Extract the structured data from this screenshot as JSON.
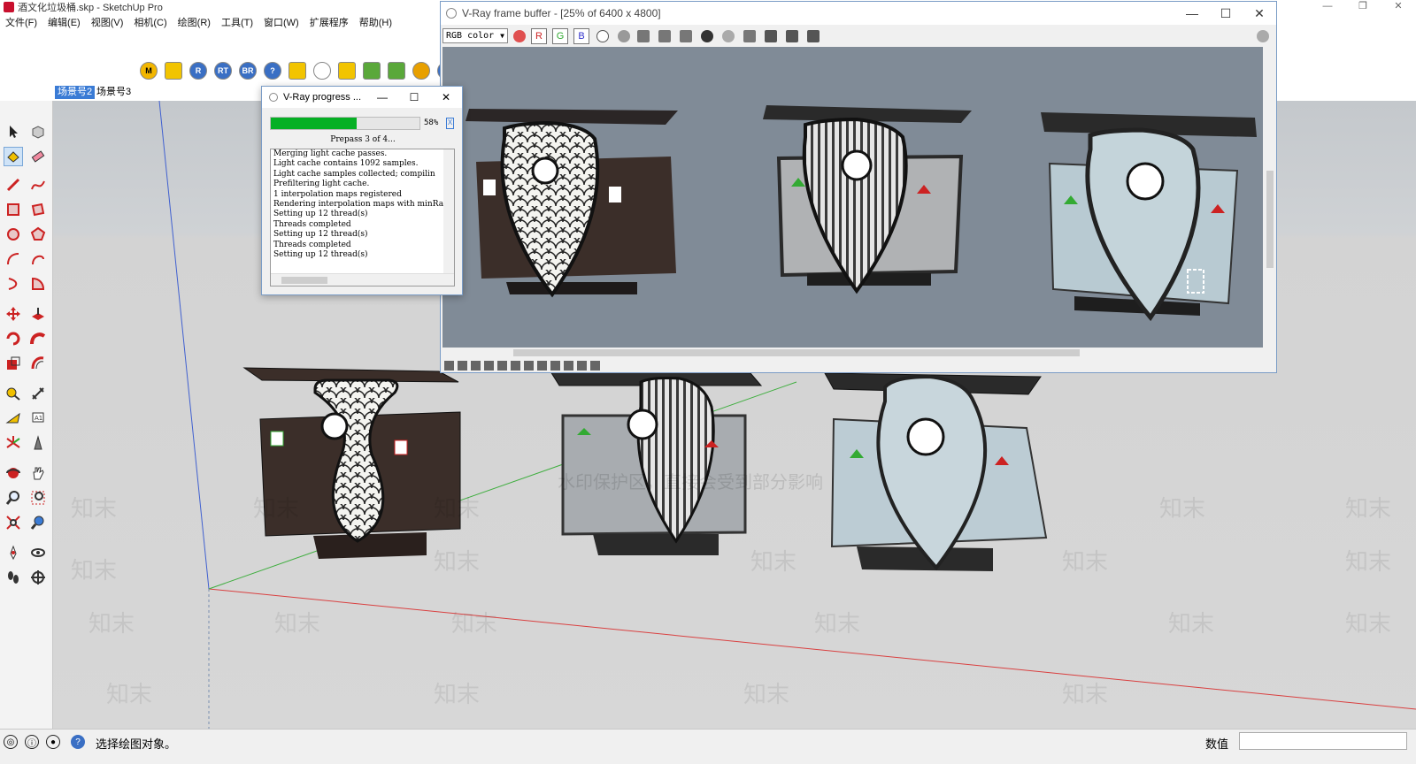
{
  "sketchup": {
    "title": "酒文化垃圾桶.skp - SketchUp Pro",
    "window_controls": [
      "—",
      "❐",
      "✕"
    ],
    "menus": [
      "文件(F)",
      "编辑(E)",
      "视图(V)",
      "相机(C)",
      "绘图(R)",
      "工具(T)",
      "窗口(W)",
      "扩展程序",
      "帮助(H)"
    ],
    "toolbar_buttons": [
      "M",
      "",
      "R",
      "RT",
      "BR",
      "?",
      "",
      "",
      "",
      "",
      "",
      "",
      ""
    ],
    "scenes": [
      {
        "label": "场景号2",
        "active": true
      },
      {
        "label": "场景号3",
        "active": false
      }
    ],
    "status": {
      "text": "选择绘图对象。",
      "measure_label": "数值",
      "measure_value": ""
    },
    "colors": {
      "accent": "#3a7bd5",
      "brand": "#c8102e",
      "axis_red": "#d94040",
      "axis_green": "#3fae3f",
      "axis_blue": "#4060d0"
    }
  },
  "vray_vfb": {
    "title": "V-Ray frame buffer - [25% of 6400 x 4800]",
    "channel": "RGB color",
    "channel_buttons": [
      "R",
      "G",
      "B"
    ],
    "window_controls": [
      "—",
      "☐",
      "✕"
    ]
  },
  "vray_progress": {
    "title": "V-Ray progress ...",
    "progress": 0.58,
    "percent_text": "58%",
    "status": "Prepass 3 of 4...",
    "stop_label": "X",
    "window_controls": [
      "—",
      "☐",
      "✕"
    ],
    "log": [
      "Merging light cache passes.",
      "Light cache contains 1092 samples.",
      "Light cache samples collected; compilin",
      "Prefiltering light cache.",
      "1 interpolation maps registered",
      "Rendering interpolation maps with minRa",
      "Setting up 12 thread(s)",
      "Threads completed",
      "Setting up 12 thread(s)",
      "Threads completed",
      "Setting up 12 thread(s)"
    ]
  },
  "model": {
    "bins": [
      {
        "style": "scale-pattern",
        "body_color": "#3b2e29",
        "panel_color": "#f4f4f0"
      },
      {
        "style": "vertical-stripes",
        "body_color": "#9ea2a6",
        "panel_color": "#e6e6e6"
      },
      {
        "style": "plain",
        "body_color": "#bcccd4",
        "panel_color": "#c8d6dc"
      }
    ],
    "watermark": "知末",
    "watermark_notice": "水印保护区，直接会受到部分影响"
  }
}
